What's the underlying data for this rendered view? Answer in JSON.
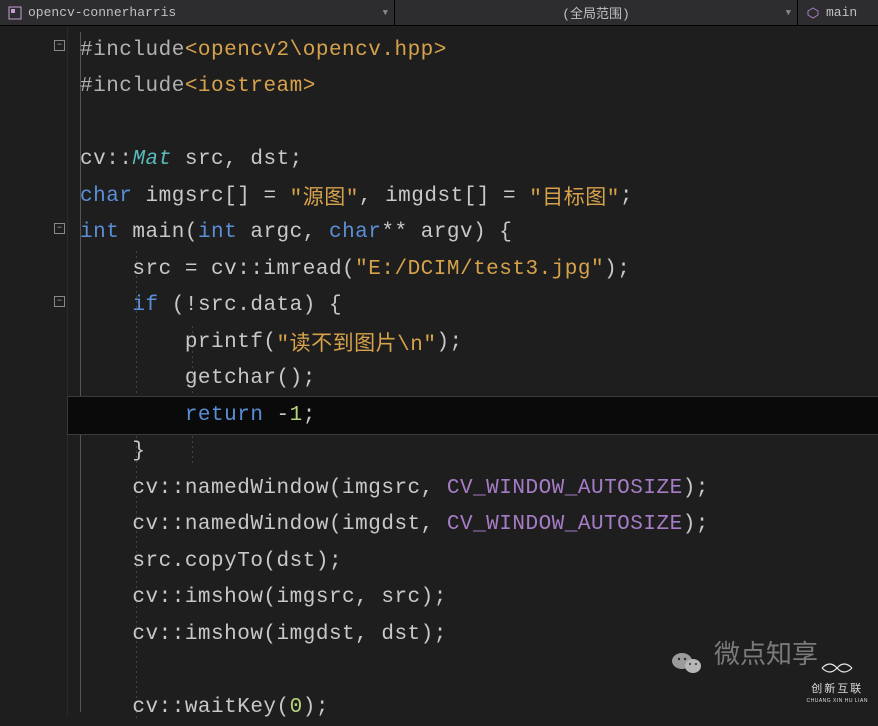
{
  "nav": {
    "project": "opencv-connerharris",
    "scope": "(全局范围)",
    "member": "main"
  },
  "code": {
    "l1_a": "#include",
    "l1_b": "<opencv2\\opencv.hpp>",
    "l2_a": "#include",
    "l2_b": "<iostream>",
    "l4_a": "cv",
    "l4_b": "::",
    "l4_c": "Mat",
    "l4_d": " src, dst;",
    "l5_a": "char",
    "l5_b": " imgsrc[] = ",
    "l5_c": "\"源图\"",
    "l5_d": ", imgdst[] = ",
    "l5_e": "\"目标图\"",
    "l5_f": ";",
    "l6_a": "int",
    "l6_b": " main(",
    "l6_c": "int",
    "l6_d": " argc, ",
    "l6_e": "char",
    "l6_f": "** argv) {",
    "l7_a": "    src = cv::imread(",
    "l7_b": "\"E:/DCIM/test3.jpg\"",
    "l7_c": ");",
    "l8_a": "    ",
    "l8_b": "if",
    "l8_c": " (!src.data) {",
    "l9_a": "        printf(",
    "l9_b": "\"读不到图片\\n\"",
    "l9_c": ");",
    "l10_a": "        getchar();",
    "l11_a": "        ",
    "l11_b": "return",
    "l11_c": " -",
    "l11_d": "1",
    "l11_e": ";",
    "l12_a": "    }",
    "l13_a": "    cv::namedWindow(imgsrc, ",
    "l13_b": "CV_WINDOW_AUTOSIZE",
    "l13_c": ");",
    "l14_a": "    cv::namedWindow(imgdst, ",
    "l14_b": "CV_WINDOW_AUTOSIZE",
    "l14_c": ");",
    "l15_a": "    src.copyTo(dst);",
    "l16_a": "    cv::imshow(imgsrc, src);",
    "l17_a": "    cv::imshow(imgdst, dst);",
    "l19_a": "    cv::waitKey(",
    "l19_b": "0",
    "l19_c": ");"
  },
  "watermark": {
    "text": "微点知享",
    "logo_top": "创新互联",
    "logo_bottom": "CHUANG XIN HU LIAN"
  }
}
